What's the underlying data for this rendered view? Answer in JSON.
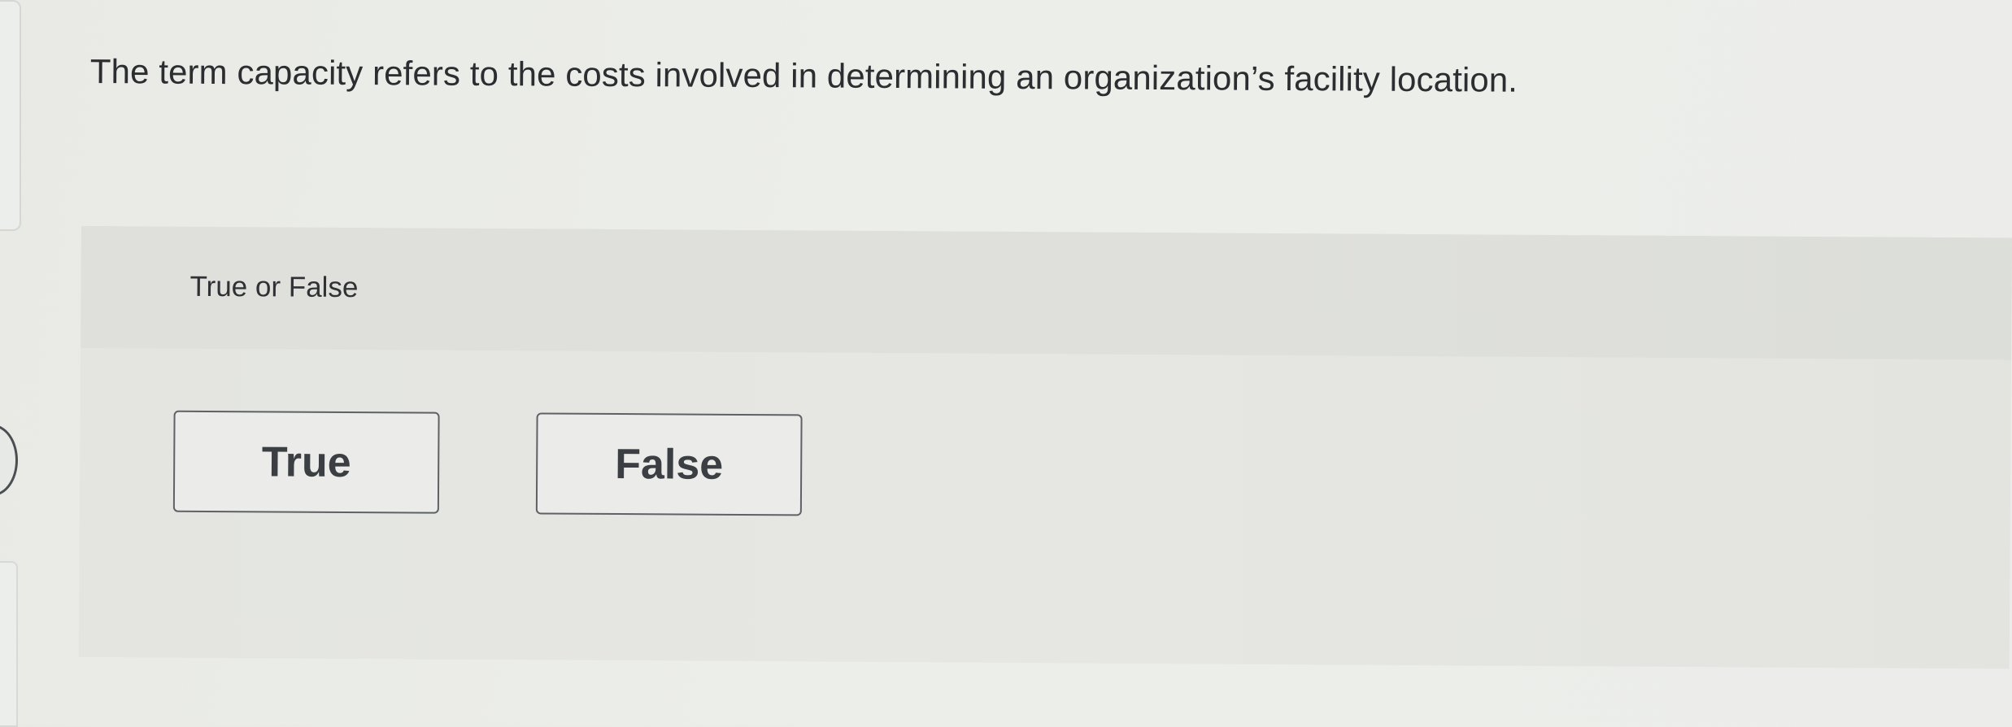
{
  "question": {
    "text": "The term capacity refers to the costs involved in determining an organization’s facility location."
  },
  "answer_panel": {
    "prompt_label": "True or False",
    "choices": [
      {
        "label": "True"
      },
      {
        "label": "False"
      }
    ]
  },
  "colors": {
    "page_background": "#ecedea",
    "panel_background": "#e4e5e1",
    "prompt_band": "#dfe0dc",
    "button_border": "#5e6165",
    "text": "#2f3133"
  }
}
